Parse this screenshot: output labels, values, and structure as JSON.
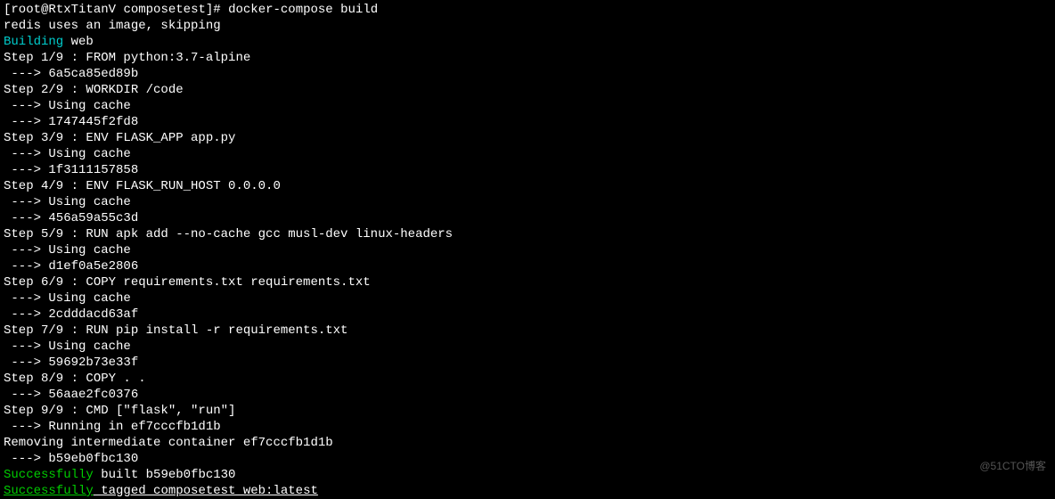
{
  "prompt": {
    "user": "root",
    "host": "RtxTitanV",
    "cwd": "composetest",
    "cmd": "docker-compose build"
  },
  "skip_line": "redis uses an image, skipping",
  "building_kw": "Building",
  "building_target": " web",
  "steps": [
    {
      "header": "Step 1/9 : FROM python:3.7-alpine",
      "lines": [
        " ---> 6a5ca85ed89b"
      ]
    },
    {
      "header": "Step 2/9 : WORKDIR /code",
      "lines": [
        " ---> Using cache",
        " ---> 1747445f2fd8"
      ]
    },
    {
      "header": "Step 3/9 : ENV FLASK_APP app.py",
      "lines": [
        " ---> Using cache",
        " ---> 1f3111157858"
      ]
    },
    {
      "header": "Step 4/9 : ENV FLASK_RUN_HOST 0.0.0.0",
      "lines": [
        " ---> Using cache",
        " ---> 456a59a55c3d"
      ]
    },
    {
      "header": "Step 5/9 : RUN apk add --no-cache gcc musl-dev linux-headers",
      "lines": [
        " ---> Using cache",
        " ---> d1ef0a5e2806"
      ]
    },
    {
      "header": "Step 6/9 : COPY requirements.txt requirements.txt",
      "lines": [
        " ---> Using cache",
        " ---> 2cdddacd63af"
      ]
    },
    {
      "header": "Step 7/9 : RUN pip install -r requirements.txt",
      "lines": [
        " ---> Using cache",
        " ---> 59692b73e33f"
      ]
    },
    {
      "header": "Step 8/9 : COPY . .",
      "lines": [
        " ---> 56aae2fc0376"
      ]
    },
    {
      "header": "Step 9/9 : CMD [\"flask\", \"run\"]",
      "lines": [
        " ---> Running in ef7cccfb1d1b"
      ]
    }
  ],
  "removing": "Removing intermediate container ef7cccfb1d1b",
  "final_hash": " ---> b59eb0fbc130",
  "success1_kw": "Successfully",
  "success1_rest": " built b59eb0fbc130",
  "success2_kw": "Successfully",
  "success2_rest": " tagged composetest_web:latest",
  "watermark": "@51CTO博客"
}
